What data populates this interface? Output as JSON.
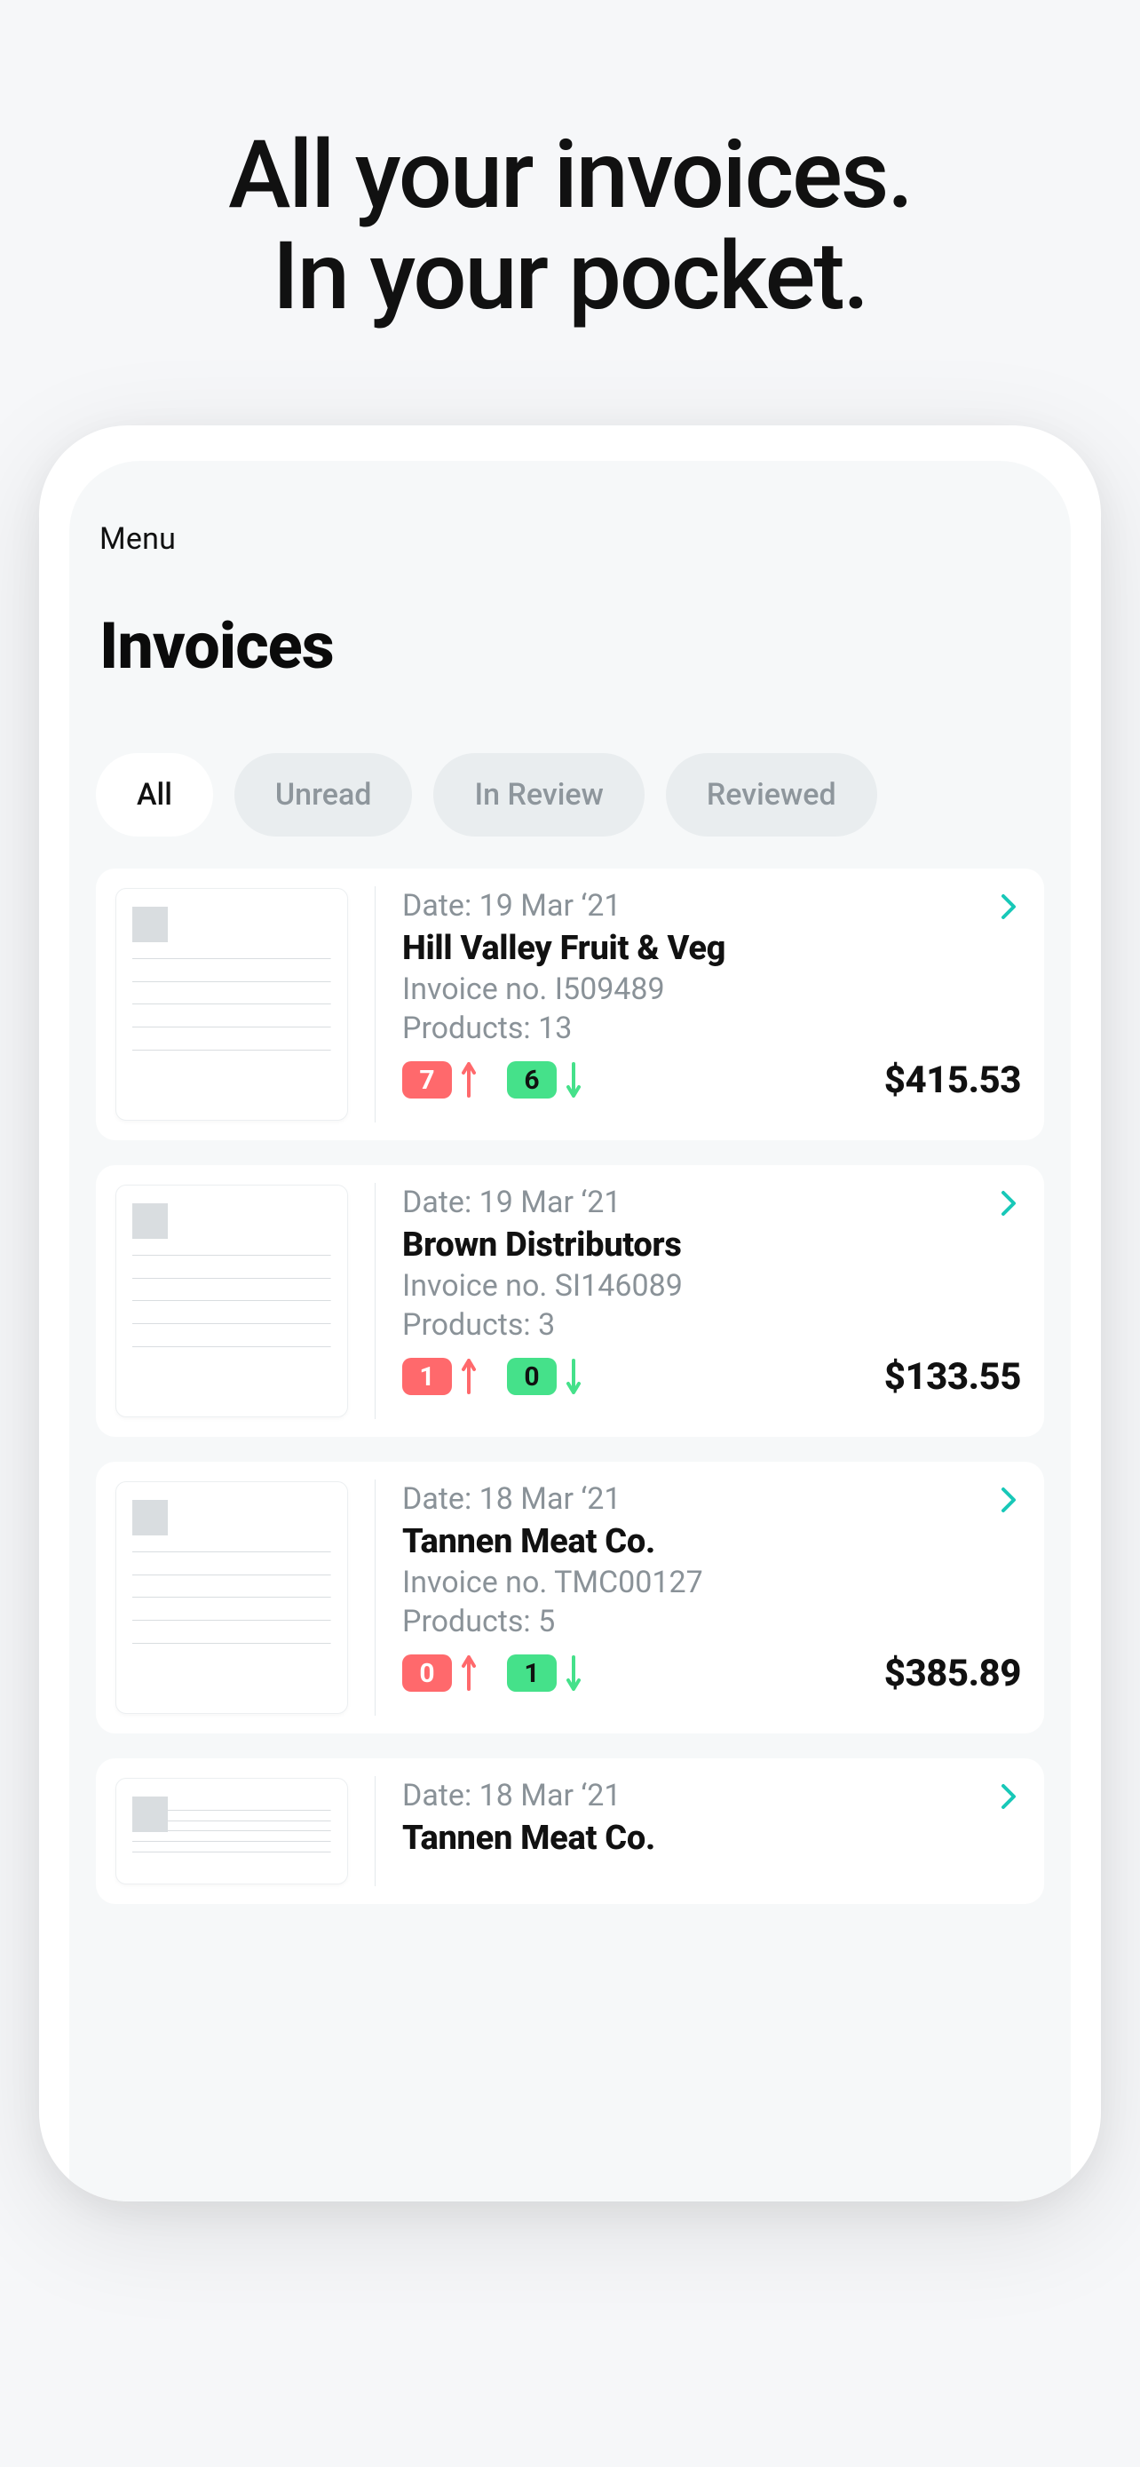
{
  "hero": {
    "line1": "All your invoices.",
    "line2": "In your pocket."
  },
  "nav": {
    "menu": "Menu"
  },
  "page": {
    "title": "Invoices"
  },
  "filters": [
    {
      "label": "All",
      "active": true
    },
    {
      "label": "Unread",
      "active": false
    },
    {
      "label": "In Review",
      "active": false
    },
    {
      "label": "Reviewed",
      "active": false
    }
  ],
  "invoices": [
    {
      "date_label": "Date: 19 Mar ‘21",
      "vendor": "Hill Valley Fruit & Veg",
      "invoice_no_label": "Invoice no. I509489",
      "products_label": "Products: 13",
      "up_count": "7",
      "down_count": "6",
      "total": "$415.53"
    },
    {
      "date_label": "Date: 19 Mar ‘21",
      "vendor": "Brown Distributors",
      "invoice_no_label": "Invoice no. SI146089",
      "products_label": "Products: 3",
      "up_count": "1",
      "down_count": "0",
      "total": "$133.55"
    },
    {
      "date_label": "Date: 18 Mar ‘21",
      "vendor": "Tannen Meat Co.",
      "invoice_no_label": "Invoice no. TMC00127",
      "products_label": "Products: 5",
      "up_count": "0",
      "down_count": "1",
      "total": "$385.89"
    },
    {
      "date_label": "Date: 18 Mar ‘21",
      "vendor": "Tannen Meat Co.",
      "invoice_no_label": "",
      "products_label": "",
      "up_count": "",
      "down_count": "",
      "total": ""
    }
  ],
  "colors": {
    "up": "#ff696c",
    "down": "#45e18a",
    "chevron": "#18c8b8"
  }
}
